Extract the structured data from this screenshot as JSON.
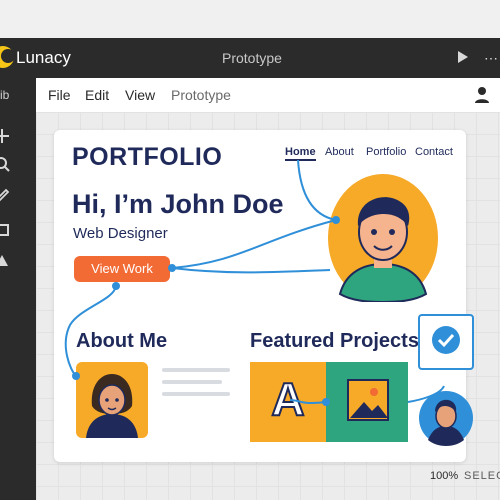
{
  "app": {
    "name": "Lunacy",
    "window_title": "Prototype",
    "toolbar_label": "ib"
  },
  "menu": [
    "File",
    "Edit",
    "View",
    "Prototype"
  ],
  "page": {
    "brand": "PORTFOLIO",
    "nav": [
      "Home",
      "About",
      "Portfolio",
      "Contact"
    ],
    "hero_title": "Hi, I’m John Doe",
    "hero_subtitle": "Web Designer",
    "cta": "View Work",
    "about_title": "About Me",
    "projects_title": "Featured Projects",
    "project_letter": "A"
  },
  "status": {
    "zoom": "100%",
    "select": "SELECT"
  },
  "icons": [
    "play-icon",
    "more-icon",
    "user-icon",
    "move-icon",
    "search-icon",
    "pen-icon",
    "rectangle-icon",
    "triangle-icon",
    "image-icon",
    "check-icon"
  ],
  "colors": {
    "accent": "#2f8fd8",
    "cta": "#f26a34",
    "navy": "#1f2a5a",
    "orange": "#f7a928",
    "green": "#2ea57e"
  }
}
